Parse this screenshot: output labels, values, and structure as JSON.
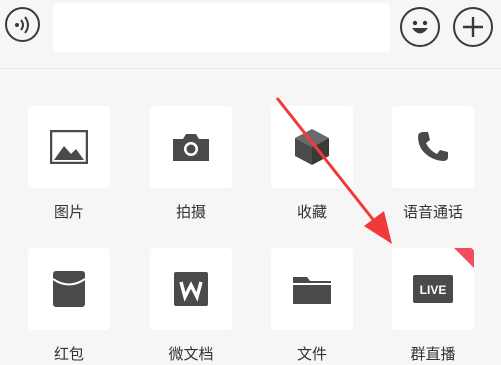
{
  "toolbar": {
    "voice_icon": "voice-icon",
    "input_value": "",
    "emoji_icon": "emoji-icon",
    "plus_icon": "plus-icon"
  },
  "panel": {
    "items": [
      {
        "label": "图片",
        "icon": "image-icon"
      },
      {
        "label": "拍摄",
        "icon": "camera-icon"
      },
      {
        "label": "收藏",
        "icon": "cube-icon"
      },
      {
        "label": "语音通话",
        "icon": "phone-icon"
      },
      {
        "label": "红包",
        "icon": "red-packet-icon"
      },
      {
        "label": "微文档",
        "icon": "w-doc-icon"
      },
      {
        "label": "文件",
        "icon": "folder-icon"
      },
      {
        "label": "群直播",
        "icon": "live-icon",
        "badge": "LIVE"
      }
    ]
  },
  "colors": {
    "icon": "#4a4a4a",
    "annotation_arrow": "#f03a3a",
    "new_corner": "#f04d5e"
  }
}
